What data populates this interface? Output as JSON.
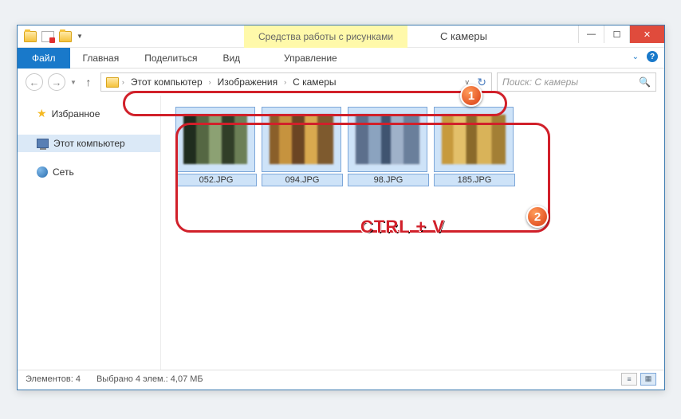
{
  "titlebar": {
    "context_label": "Средства работы с рисунками",
    "window_title": "С камеры",
    "min": "—",
    "max": "☐",
    "close": "✕"
  },
  "ribbon": {
    "file": "Файл",
    "home": "Главная",
    "share": "Поделиться",
    "view": "Вид",
    "manage": "Управление",
    "expand": "⌄",
    "help": "?"
  },
  "nav": {
    "back": "←",
    "forward": "→",
    "up": "↑",
    "refresh": "↻"
  },
  "breadcrumb": {
    "root": "Этот компьютер",
    "lvl1": "Изображения",
    "lvl2": "С камеры",
    "sep": "›"
  },
  "search": {
    "placeholder": "Поиск: С камеры",
    "icon": "🔍"
  },
  "sidebar": {
    "favorites": "Избранное",
    "this_pc": "Этот компьютер",
    "network": "Сеть"
  },
  "files": [
    {
      "name": "052.JPG"
    },
    {
      "name": "094.JPG"
    },
    {
      "name": "98.JPG"
    },
    {
      "name": "185.JPG"
    }
  ],
  "status": {
    "count": "Элементов: 4",
    "selection": "Выбрано 4 элем.:  4,07 МБ"
  },
  "annotation": {
    "badge1": "1",
    "badge2": "2",
    "shortcut": "CTRL + V"
  }
}
